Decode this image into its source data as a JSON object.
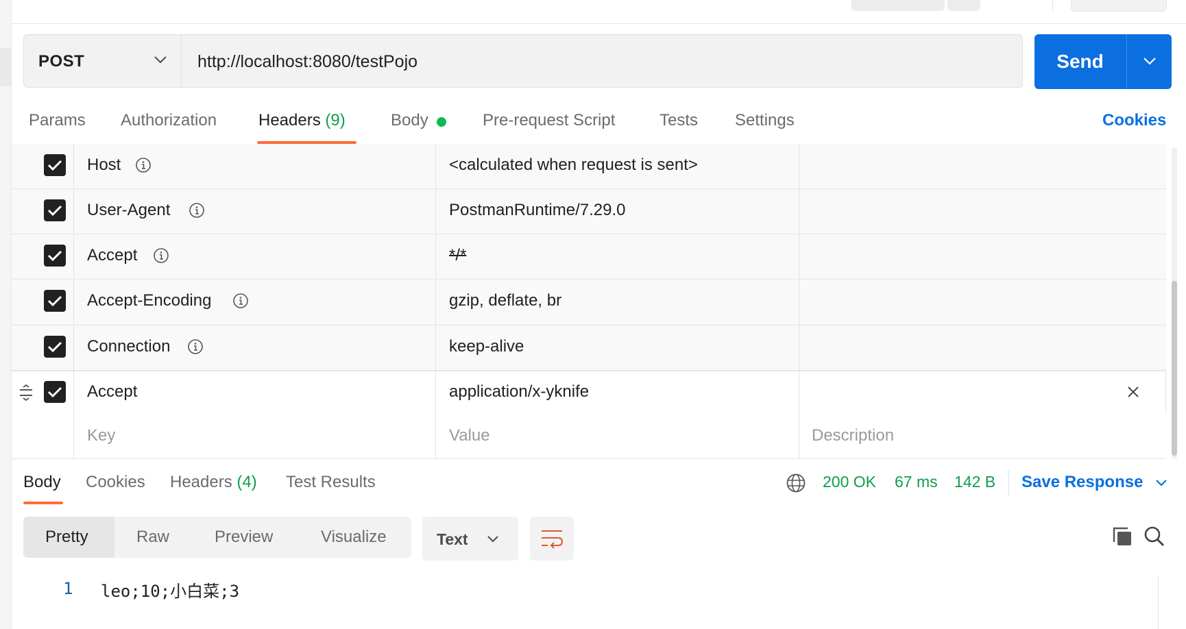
{
  "request": {
    "method": "POST",
    "url": "http://localhost:8080/testPojo",
    "send_label": "Send"
  },
  "tabs": [
    {
      "label": "Params"
    },
    {
      "label": "Authorization"
    },
    {
      "label": "Headers",
      "count": "(9)"
    },
    {
      "label": "Body"
    },
    {
      "label": "Pre-request Script"
    },
    {
      "label": "Tests"
    },
    {
      "label": "Settings"
    }
  ],
  "cookies_label": "Cookies",
  "headers_table": {
    "rows": [
      {
        "key": "Host",
        "value": "<calculated when request is sent>",
        "checked": true,
        "info": true
      },
      {
        "key": "User-Agent",
        "value": "PostmanRuntime/7.29.0",
        "checked": true,
        "info": true
      },
      {
        "key": "Accept",
        "value": "*/*",
        "checked": true,
        "info": true
      },
      {
        "key": "Accept-Encoding",
        "value": "gzip, deflate, br",
        "checked": true,
        "info": true
      },
      {
        "key": "Connection",
        "value": "keep-alive",
        "checked": true,
        "info": true
      },
      {
        "key": "Accept",
        "value": "application/x-yknife",
        "checked": true,
        "info": false
      }
    ],
    "placeholders": {
      "key": "Key",
      "value": "Value",
      "description": "Description"
    }
  },
  "response": {
    "tabs": [
      {
        "label": "Body"
      },
      {
        "label": "Cookies"
      },
      {
        "label": "Headers",
        "count": "(4)"
      },
      {
        "label": "Test Results"
      }
    ],
    "status": "200 OK",
    "time": "67 ms",
    "size": "142 B",
    "save_label": "Save Response",
    "formats": [
      "Pretty",
      "Raw",
      "Preview",
      "Visualize"
    ],
    "type": "Text",
    "line_number": "1",
    "body": "leo;10;小白菜;3"
  },
  "colors": {
    "accent": "#ff6c37",
    "primary": "#0b6fe0",
    "success": "#0f9d4a"
  }
}
